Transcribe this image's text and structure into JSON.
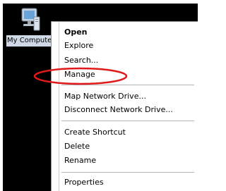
{
  "desktop": {
    "icon": {
      "name": "computer-icon",
      "label": "My Computer"
    }
  },
  "context_menu": {
    "items": [
      {
        "label": "Open",
        "bold": true
      },
      {
        "label": "Explore"
      },
      {
        "label": "Search..."
      },
      {
        "label": "Manage"
      },
      {
        "label": "Map Network Drive..."
      },
      {
        "label": "Disconnect Network Drive..."
      },
      {
        "label": "Create Shortcut"
      },
      {
        "label": "Delete"
      },
      {
        "label": "Rename"
      },
      {
        "label": "Properties"
      }
    ],
    "highlighted_item": "Manage"
  },
  "colors": {
    "background": "#000000",
    "menu_background": "#ffffff",
    "annotation": "#e0191a",
    "icon_label_background": "#cfd9e6"
  }
}
